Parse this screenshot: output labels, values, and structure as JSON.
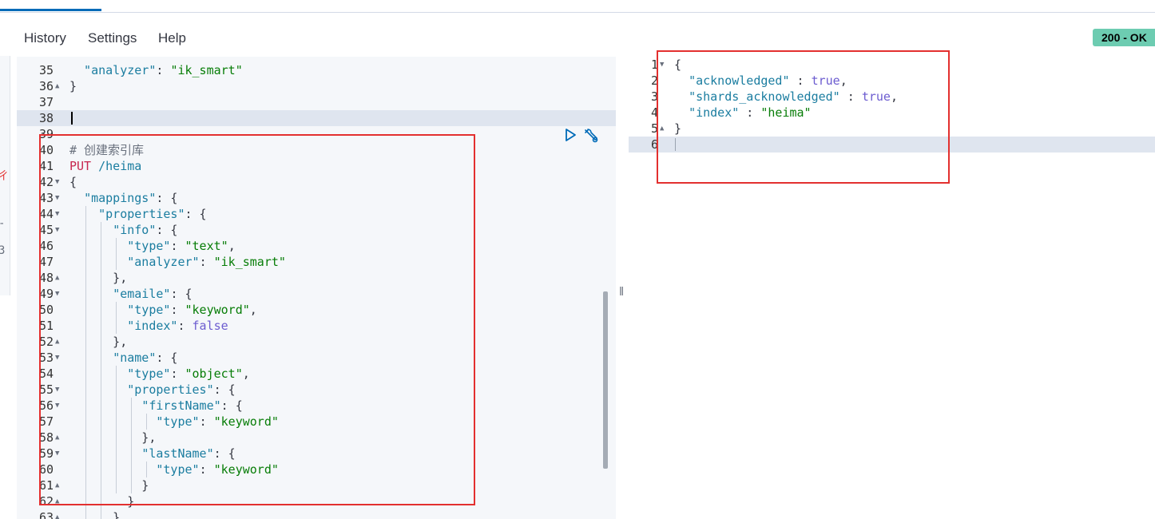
{
  "menu": {
    "history": "History",
    "settings": "Settings",
    "help": "Help"
  },
  "status": "200 - OK",
  "left_edge_chars": [
    "ㄔ",
    "-",
    "3"
  ],
  "colors": {
    "status_bg": "#6dccb1",
    "annotation_red": "#e3302f",
    "active_tab": "#006bb8"
  },
  "icons": {
    "run": "play-triangle-icon",
    "settings": "wrench-icon",
    "fold_open": "triangle-down",
    "fold_close": "triangle-up"
  },
  "request_editor": {
    "lines": [
      {
        "num": "35",
        "tokens": [
          [
            "k",
            "  \"analyzer\""
          ],
          [
            "p",
            ": "
          ],
          [
            "s",
            "\"ik_smart\""
          ]
        ]
      },
      {
        "num": "36",
        "fold": "up",
        "tokens": [
          [
            "p",
            "}"
          ]
        ]
      },
      {
        "num": "37",
        "tokens": []
      },
      {
        "num": "38",
        "active": true,
        "tokens": []
      },
      {
        "num": "39",
        "tokens": []
      },
      {
        "num": "40",
        "tokens": [
          [
            "c",
            "# 创建索引库"
          ]
        ]
      },
      {
        "num": "41",
        "tokens": [
          [
            "m",
            "PUT"
          ],
          [
            "p",
            " "
          ],
          [
            "u",
            "/heima"
          ]
        ]
      },
      {
        "num": "42",
        "fold": "down",
        "tokens": [
          [
            "p",
            "{"
          ]
        ]
      },
      {
        "num": "43",
        "fold": "down",
        "tokens": [
          [
            "p",
            "  "
          ],
          [
            "k",
            "\"mappings\""
          ],
          [
            "p",
            ": {"
          ]
        ]
      },
      {
        "num": "44",
        "fold": "down",
        "tokens": [
          [
            "p",
            "    "
          ],
          [
            "k",
            "\"properties\""
          ],
          [
            "p",
            ": {"
          ]
        ]
      },
      {
        "num": "45",
        "fold": "down",
        "tokens": [
          [
            "p",
            "      "
          ],
          [
            "k",
            "\"info\""
          ],
          [
            "p",
            ": {"
          ]
        ]
      },
      {
        "num": "46",
        "tokens": [
          [
            "p",
            "        "
          ],
          [
            "k",
            "\"type\""
          ],
          [
            "p",
            ": "
          ],
          [
            "s",
            "\"text\""
          ],
          [
            "p",
            ","
          ]
        ]
      },
      {
        "num": "47",
        "tokens": [
          [
            "p",
            "        "
          ],
          [
            "k",
            "\"analyzer\""
          ],
          [
            "p",
            ": "
          ],
          [
            "s",
            "\"ik_smart\""
          ]
        ]
      },
      {
        "num": "48",
        "fold": "up",
        "tokens": [
          [
            "p",
            "      },"
          ]
        ]
      },
      {
        "num": "49",
        "fold": "down",
        "tokens": [
          [
            "p",
            "      "
          ],
          [
            "k",
            "\"emaile\""
          ],
          [
            "p",
            ": {"
          ]
        ]
      },
      {
        "num": "50",
        "tokens": [
          [
            "p",
            "        "
          ],
          [
            "k",
            "\"type\""
          ],
          [
            "p",
            ": "
          ],
          [
            "s",
            "\"keyword\""
          ],
          [
            "p",
            ","
          ]
        ]
      },
      {
        "num": "51",
        "tokens": [
          [
            "p",
            "        "
          ],
          [
            "k",
            "\"index\""
          ],
          [
            "p",
            ": "
          ],
          [
            "b",
            "false"
          ]
        ]
      },
      {
        "num": "52",
        "fold": "up",
        "tokens": [
          [
            "p",
            "      },"
          ]
        ]
      },
      {
        "num": "53",
        "fold": "down",
        "tokens": [
          [
            "p",
            "      "
          ],
          [
            "k",
            "\"name\""
          ],
          [
            "p",
            ": {"
          ]
        ]
      },
      {
        "num": "54",
        "tokens": [
          [
            "p",
            "        "
          ],
          [
            "k",
            "\"type\""
          ],
          [
            "p",
            ": "
          ],
          [
            "s",
            "\"object\""
          ],
          [
            "p",
            ","
          ]
        ]
      },
      {
        "num": "55",
        "fold": "down",
        "tokens": [
          [
            "p",
            "        "
          ],
          [
            "k",
            "\"properties\""
          ],
          [
            "p",
            ": {"
          ]
        ]
      },
      {
        "num": "56",
        "fold": "down",
        "tokens": [
          [
            "p",
            "          "
          ],
          [
            "k",
            "\"firstName\""
          ],
          [
            "p",
            ": {"
          ]
        ]
      },
      {
        "num": "57",
        "tokens": [
          [
            "p",
            "            "
          ],
          [
            "k",
            "\"type\""
          ],
          [
            "p",
            ": "
          ],
          [
            "s",
            "\"keyword\""
          ]
        ]
      },
      {
        "num": "58",
        "fold": "up",
        "tokens": [
          [
            "p",
            "          },"
          ]
        ]
      },
      {
        "num": "59",
        "fold": "down",
        "tokens": [
          [
            "p",
            "          "
          ],
          [
            "k",
            "\"lastName\""
          ],
          [
            "p",
            ": {"
          ]
        ]
      },
      {
        "num": "60",
        "tokens": [
          [
            "p",
            "            "
          ],
          [
            "k",
            "\"type\""
          ],
          [
            "p",
            ": "
          ],
          [
            "s",
            "\"keyword\""
          ]
        ]
      },
      {
        "num": "61",
        "fold": "up",
        "tokens": [
          [
            "p",
            "          }"
          ]
        ]
      },
      {
        "num": "62",
        "fold": "up",
        "tokens": [
          [
            "p",
            "        }"
          ]
        ]
      },
      {
        "num": "63",
        "fold": "up",
        "tokens": [
          [
            "p",
            "      }"
          ]
        ]
      }
    ]
  },
  "response_editor": {
    "lines": [
      {
        "num": "1",
        "fold": "down",
        "tokens": [
          [
            "p",
            "{"
          ]
        ]
      },
      {
        "num": "2",
        "tokens": [
          [
            "p",
            "  "
          ],
          [
            "k",
            "\"acknowledged\""
          ],
          [
            "p",
            " : "
          ],
          [
            "b",
            "true"
          ],
          [
            "p",
            ","
          ]
        ]
      },
      {
        "num": "3",
        "tokens": [
          [
            "p",
            "  "
          ],
          [
            "k",
            "\"shards_acknowledged\""
          ],
          [
            "p",
            " : "
          ],
          [
            "b",
            "true"
          ],
          [
            "p",
            ","
          ]
        ]
      },
      {
        "num": "4",
        "tokens": [
          [
            "p",
            "  "
          ],
          [
            "k",
            "\"index\""
          ],
          [
            "p",
            " : "
          ],
          [
            "s",
            "\"heima\""
          ]
        ]
      },
      {
        "num": "5",
        "fold": "up",
        "tokens": [
          [
            "p",
            "}"
          ]
        ]
      },
      {
        "num": "6",
        "active": true,
        "tokens": []
      }
    ]
  }
}
